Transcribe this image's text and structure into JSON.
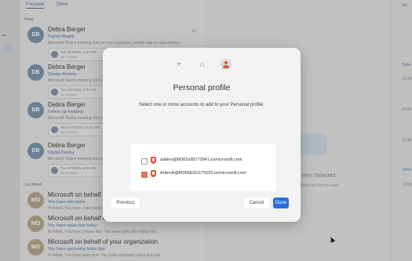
{
  "tabs": [
    "Focused",
    "Other"
  ],
  "groups": {
    "today": "Today",
    "last_week": "Last Week"
  },
  "messages": [
    {
      "initials": "DB",
      "sender": "Debra Berger",
      "subject": "Digital Weight",
      "preview": "Microsoft Teams meeting Join on your computer, mobile app or room device",
      "att1": "Tue 4/7/2025, 4:00 PM",
      "att2": "No Conflicts"
    },
    {
      "initials": "DB",
      "sender": "Debra Berger",
      "subject": "Design Review",
      "preview": "Microsoft Teams meeting Join on your computer, mobile app or room device",
      "att1": "Tue 4/7/2025, 4:00 PM",
      "att2": "No Conflicts"
    },
    {
      "initials": "DB",
      "sender": "Debra Berger",
      "subject": "Follow up meeting",
      "preview": "Microsoft Teams meeting Join on your computer, mobile app or room device",
      "att1": "Wed 4/7/2025, 10:00 AM",
      "att2": "No Conflicts"
    },
    {
      "initials": "DB",
      "sender": "Debra Berger",
      "subject": "Digital Deploy",
      "preview": "Microsoft Teams meeting Join on your computer, mobile app or room device",
      "att1": "Tue 4/7/2025, 4:00 PM",
      "att2": "No Conflicts"
    },
    {
      "initials": "MO",
      "sender": "Microsoft on behalf of your organization",
      "subject": "You have late tasks",
      "preview": "Hi Adele, You have 2 late tasks due today"
    },
    {
      "initials": "MO",
      "sender": "Microsoft on behalf of your organization",
      "subject": "You have tasks due today",
      "preview": "Hi Adele, You have 3 tasks due. You have tasks due today mic..."
    },
    {
      "initials": "MO",
      "sender": "Microsoft on behalf of your organization",
      "subject": "You have upcoming tasks due",
      "preview": "Hi Adele, You have tasks due. You have upcoming tasks due late ..."
    }
  ],
  "reading_pane": {
    "title": "No item Selected",
    "subtitle": "Select an item to read"
  },
  "calendar": {
    "header": "Apr",
    "today": "Toda",
    "times": [
      "10:30",
      "11:00",
      "11:30",
      "12:00"
    ],
    "tomorrow": "Tomo"
  },
  "dialog": {
    "title": "Personal profile",
    "description": "Select one or more accounts to add to your Personal profile.",
    "accounts": [
      {
        "email": "adelev@M365x98772841.onmicrosoft.com",
        "checked": false
      },
      {
        "email": "ArdenA@M365EDU175020.onmicrosoft.com",
        "checked": true
      }
    ],
    "buttons": {
      "previous": "Previous",
      "cancel": "Cancel",
      "done": "Done"
    }
  },
  "colors": {
    "accent": "#2a6ed8",
    "profile": "#d6573d"
  }
}
